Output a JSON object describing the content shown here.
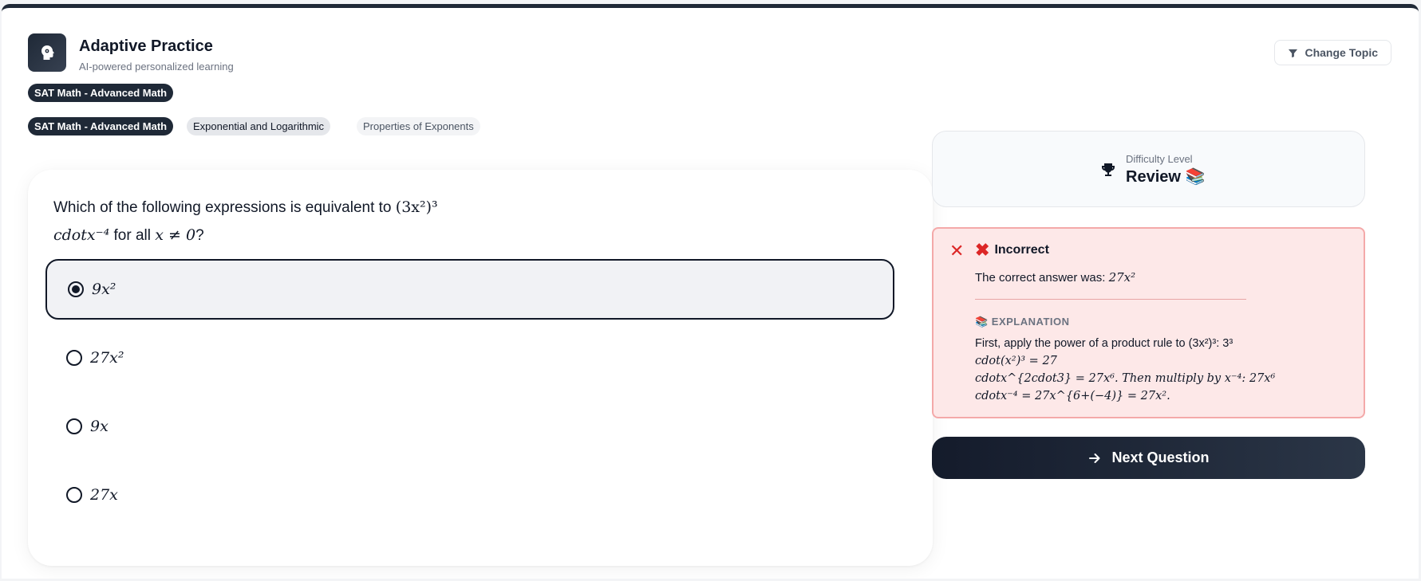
{
  "header": {
    "title": "Adaptive Practice",
    "subtitle": "AI-powered personalized learning",
    "change_topic_label": "Change Topic",
    "topic_pill": "SAT Math - Advanced Math"
  },
  "breadcrumb": {
    "items": [
      "SAT Math - Advanced Math",
      "Exponential and Logarithmic",
      "Properties of Exponents"
    ]
  },
  "question": {
    "prefix": "Which of the following expressions is equivalent to",
    "expr_line1": "(3x²)³",
    "expr_line2": "cdotx⁻⁴",
    "suffix": "for all",
    "condition": "x ≠ 0",
    "end": "?",
    "options": [
      {
        "label": "9x²",
        "selected": true
      },
      {
        "label": "27x²",
        "selected": false
      },
      {
        "label": "9x",
        "selected": false
      },
      {
        "label": "27x",
        "selected": false
      }
    ]
  },
  "difficulty": {
    "label": "Difficulty Level",
    "value": "Review 📚"
  },
  "feedback": {
    "status": "Incorrect",
    "answer_prefix": "The correct answer was:",
    "answer_value": "27x²",
    "explanation_heading": "📚 EXPLANATION",
    "explanation_lines": [
      "First, apply the power of a product rule to (3x²)³: 3³",
      "cdot(x²)³ = 27",
      "cdotx^{2cdot3} = 27x⁶. Then multiply by x⁻⁴: 27x⁶",
      "cdotx⁻⁴ = 27x^{6+(−4)} = 27x²."
    ]
  },
  "actions": {
    "next_label": "Next Question"
  },
  "colors": {
    "primary": "#1f2937",
    "error_bg": "#fde8e8",
    "error_border": "#f4a9a9",
    "error_text": "#dc2626"
  },
  "icons": {
    "logo": "brain-gear-icon",
    "filter": "filter-icon",
    "trophy": "trophy-icon",
    "close": "close-icon",
    "incorrect": "x-mark-icon",
    "next": "arrow-right-icon"
  }
}
